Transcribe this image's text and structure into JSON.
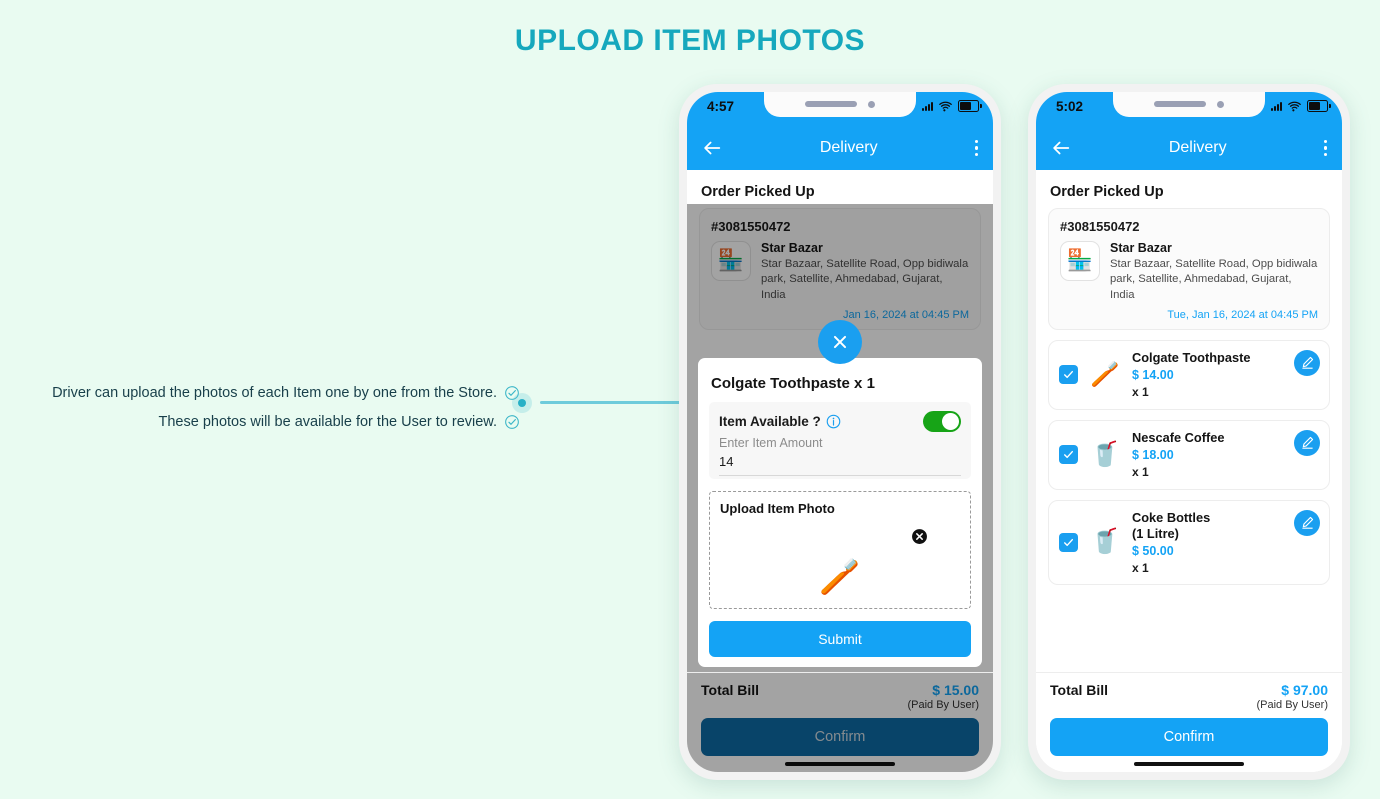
{
  "page": {
    "title": "UPLOAD ITEM PHOTOS",
    "title_color": "#16a8bd",
    "background": "#e9fbf1"
  },
  "annotations": [
    {
      "text": "Driver can upload the photos of each Item one by one from the Store.",
      "icon": "circle-check-icon"
    },
    {
      "text": "These photos will be available for the User to review.",
      "icon": "circle-check-icon"
    }
  ],
  "accent": {
    "blue": "#14a3f5",
    "teal": "#27b0c6",
    "green": "#17a417"
  },
  "phone_left": {
    "status": {
      "time": "4:57",
      "signal_icon": "signal-icon",
      "wifi_icon": "wifi-icon",
      "battery_icon": "battery-icon"
    },
    "appbar": {
      "back_icon": "back-arrow-icon",
      "title": "Delivery",
      "menu_icon": "kebab-menu-icon"
    },
    "section_title": "Order Picked Up",
    "order": {
      "id": "#3081550472",
      "store_icon": "store-icon",
      "store_name": "Star Bazar",
      "store_address": "Star Bazaar, Satellite Road, Opp bidiwala park, Satellite, Ahmedabad, Gujarat, India",
      "timestamp": "Jan 16, 2024 at 04:45 PM"
    },
    "modal": {
      "close_icon": "close-x-icon",
      "title": "Colgate Toothpaste  x 1",
      "available_label": "Item Available ?",
      "info_icon": "info-icon",
      "toggle_state": "on",
      "amount_placeholder": "Enter Item Amount",
      "amount_value": "14",
      "upload_label": "Upload Item Photo",
      "remove_icon": "remove-x-icon",
      "photo_icon": "toothpaste-photo",
      "submit_label": "Submit"
    },
    "footer": {
      "bill_label": "Total Bill",
      "bill_amount": "$ 15.00",
      "paid_by": "(Paid By User)",
      "confirm_label": "Confirm"
    }
  },
  "phone_right": {
    "status": {
      "time": "5:02",
      "signal_icon": "signal-icon",
      "wifi_icon": "wifi-icon",
      "battery_icon": "battery-icon"
    },
    "appbar": {
      "back_icon": "back-arrow-icon",
      "title": "Delivery",
      "menu_icon": "kebab-menu-icon"
    },
    "section_title": "Order Picked Up",
    "order": {
      "id": "#3081550472",
      "store_icon": "store-icon",
      "store_name": "Star Bazar",
      "store_address": "Star Bazaar, Satellite Road, Opp bidiwala park, Satellite, Ahmedabad, Gujarat, India",
      "timestamp": "Tue, Jan 16, 2024 at 04:45 PM"
    },
    "items": [
      {
        "name": "Colgate Toothpaste",
        "price": "$ 14.00",
        "qty": "x 1",
        "checked": true,
        "thumb": "toothpaste-photo",
        "edit_icon": "edit-pencil-icon"
      },
      {
        "name": "Nescafe Coffee",
        "price": "$ 18.00",
        "qty": "x 1",
        "checked": true,
        "thumb": "coffee-photo",
        "edit_icon": "edit-pencil-icon"
      },
      {
        "name": "Coke Bottles\n(1 Litre)",
        "price": "$ 50.00",
        "qty": "x 1",
        "checked": true,
        "thumb": "coke-photo",
        "edit_icon": "edit-pencil-icon"
      }
    ],
    "footer": {
      "bill_label": "Total Bill",
      "bill_amount": "$ 97.00",
      "paid_by": "(Paid By User)",
      "confirm_label": "Confirm"
    }
  }
}
